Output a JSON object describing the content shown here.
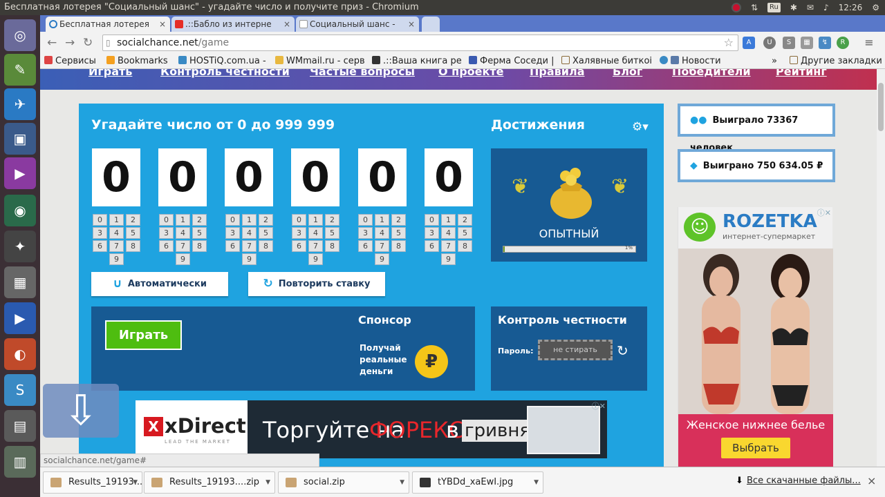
{
  "window": {
    "title": "Бесплатная лотерея \"Социальный шанс\" - угадайте число и получите приз - Chromium"
  },
  "system_tray": {
    "keyboard_layout": "Ru",
    "clock": "12:26"
  },
  "tabs": [
    {
      "label": "Бесплатная лотерея",
      "favicon": "loading-spinner-icon",
      "active": true
    },
    {
      "label": ".::Бабло из интерне",
      "favicon": "youtube-icon",
      "active": false
    },
    {
      "label": "Социальный шанс -",
      "favicon": "page-icon",
      "active": false
    }
  ],
  "address_bar": {
    "domain": "socialchance.net",
    "path": "/game"
  },
  "bookmarks": [
    {
      "label": "Сервисы"
    },
    {
      "label": "Bookmarks"
    },
    {
      "label": "HOSTiQ.com.ua -"
    },
    {
      "label": "WMmail.ru - серв"
    },
    {
      "label": ".::Ваша книга ре"
    },
    {
      "label": "Ферма Соседи |"
    },
    {
      "label": "Халявные биткоі"
    },
    {
      "label": "Новости"
    }
  ],
  "bookmarks_more": "»",
  "other_bookmarks": "Другие закладки",
  "site_nav": [
    "Играть",
    "Контроль честности",
    "Частые вопросы",
    "О проекте",
    "Правила",
    "Блог",
    "Победители",
    "Рейтинг"
  ],
  "game": {
    "heading": "Угадайте число от 0 до 999 999",
    "digits": [
      "0",
      "0",
      "0",
      "0",
      "0",
      "0"
    ],
    "keypad_keys": [
      "0",
      "1",
      "2",
      "3",
      "4",
      "5",
      "6",
      "7",
      "8",
      "9"
    ],
    "auto_button": "Автоматически",
    "repeat_button": "Повторить ставку",
    "play_button": "Играть",
    "sponsor_heading": "Спонсор",
    "sponsor_text": "Получай реальные деньги",
    "sponsor_icon": "ruble-coin-icon",
    "ruble_symbol": "₽"
  },
  "achievements": {
    "heading": "Достижения",
    "level": "ОПЫТНЫЙ",
    "progress": 1,
    "progress_label": "1%"
  },
  "honesty": {
    "heading": "Контроль честности",
    "password_label": "Пароль:",
    "password_value": "не стирать"
  },
  "stats": {
    "winners": "Выиграло 73367 человек",
    "amount": "Выиграно 750 634.05 ₽"
  },
  "xdirect_ad": {
    "mark": "X",
    "brand": "xDirect",
    "tagline": "LEAD THE MARKET",
    "slogan_1": "Торгуйте на",
    "slogan_2": "ФОРЕКС",
    "slogan_3": "в",
    "slogan_4": "гривнях"
  },
  "rozetka_ad": {
    "brand": "ROZETKA",
    "tagline": "интернет-супермаркет",
    "caption": "Женское нижнее белье",
    "button": "Выбрать"
  },
  "status_url": "socialchance.net/game#",
  "downloads": [
    {
      "name": "Results_19193....zip"
    },
    {
      "name": "Results_19193....zip"
    },
    {
      "name": "social.zip"
    },
    {
      "name": "tYBDd_xaEwI.jpg"
    }
  ],
  "all_downloads": "Все скачанные файлы...",
  "colors": {
    "panel_blue": "#1fa3e0",
    "panel_dark": "#175a93",
    "play_green": "#4ebd10",
    "rozetka_pink": "#d8305a"
  }
}
